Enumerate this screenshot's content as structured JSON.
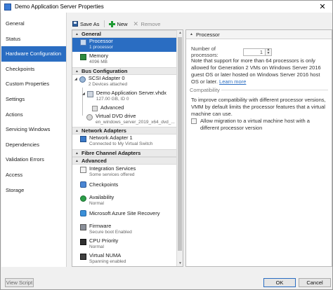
{
  "window": {
    "title": "Demo Application Server Properties",
    "close_glyph": "✕"
  },
  "nav": {
    "items": [
      {
        "label": "General",
        "active": false
      },
      {
        "label": "Status",
        "active": false
      },
      {
        "label": "Hardware Configuration",
        "active": true
      },
      {
        "label": "Checkpoints",
        "active": false
      },
      {
        "label": "Custom Properties",
        "active": false
      },
      {
        "label": "Settings",
        "active": false
      },
      {
        "label": "Actions",
        "active": false
      },
      {
        "label": "Servicing Windows",
        "active": false
      },
      {
        "label": "Dependencies",
        "active": false
      },
      {
        "label": "Validation Errors",
        "active": false
      },
      {
        "label": "Access",
        "active": false
      },
      {
        "label": "Storage",
        "active": false
      }
    ]
  },
  "toolbar": {
    "save_as": "Save As",
    "new": "New",
    "remove": "Remove"
  },
  "tree": {
    "sections": {
      "general": "General",
      "bus": "Bus Configuration",
      "network": "Network Adapters",
      "fibre": "Fibre Channel Adapters",
      "advanced": "Advanced"
    },
    "processor": {
      "label": "Processor",
      "sub": "1 processor"
    },
    "memory": {
      "label": "Memory",
      "sub": "4096 MB"
    },
    "scsi": {
      "label": "SCSI Adapter 0",
      "sub": "2 Devices attached"
    },
    "vhdx": {
      "label": "Demo Application Server.vhdx",
      "sub": "127.00 GB, ID 0"
    },
    "vhdx_advanced": "Advanced",
    "dvd": {
      "label": "Virtual DVD drive",
      "sub": "en_windows_server_2019_x64_dvd_..."
    },
    "net1": {
      "label": "Network Adapter 1",
      "sub": "Connected to My Virtual Switch"
    },
    "integration": {
      "label": "Integration Services",
      "sub": "Some services offered"
    },
    "checkpoints": {
      "label": "Checkpoints"
    },
    "availability": {
      "label": "Availability",
      "sub": "Normal"
    },
    "asr": {
      "label": "Microsoft Azure Site Recovery"
    },
    "firmware": {
      "label": "Firmware",
      "sub": "Secure boot Enabled"
    },
    "cpu_priority": {
      "label": "CPU Priority",
      "sub": "Normal"
    },
    "numa": {
      "label": "Virtual NUMA",
      "sub": "Spanning enabled"
    }
  },
  "panel": {
    "header": "Processor",
    "num_label": "Number of processors:",
    "num_value": "1",
    "note": "Note that support for more than 64 processors is only allowed for Generation 2 VMs on Windows Server 2016 guest OS or later hosted on Windows Server 2016 host OS or later.",
    "learn_more": "Learn more",
    "compat_title": "Compatibility",
    "compat_text": "To improve compatibility with different processor versions, VMM by default limits the processor features that a virtual machine can use.",
    "compat_check_label": "Allow migration to a virtual machine host with a different processor version",
    "compat_checked": false
  },
  "footer": {
    "view_script": "View Script",
    "ok": "OK",
    "cancel": "Cancel"
  }
}
